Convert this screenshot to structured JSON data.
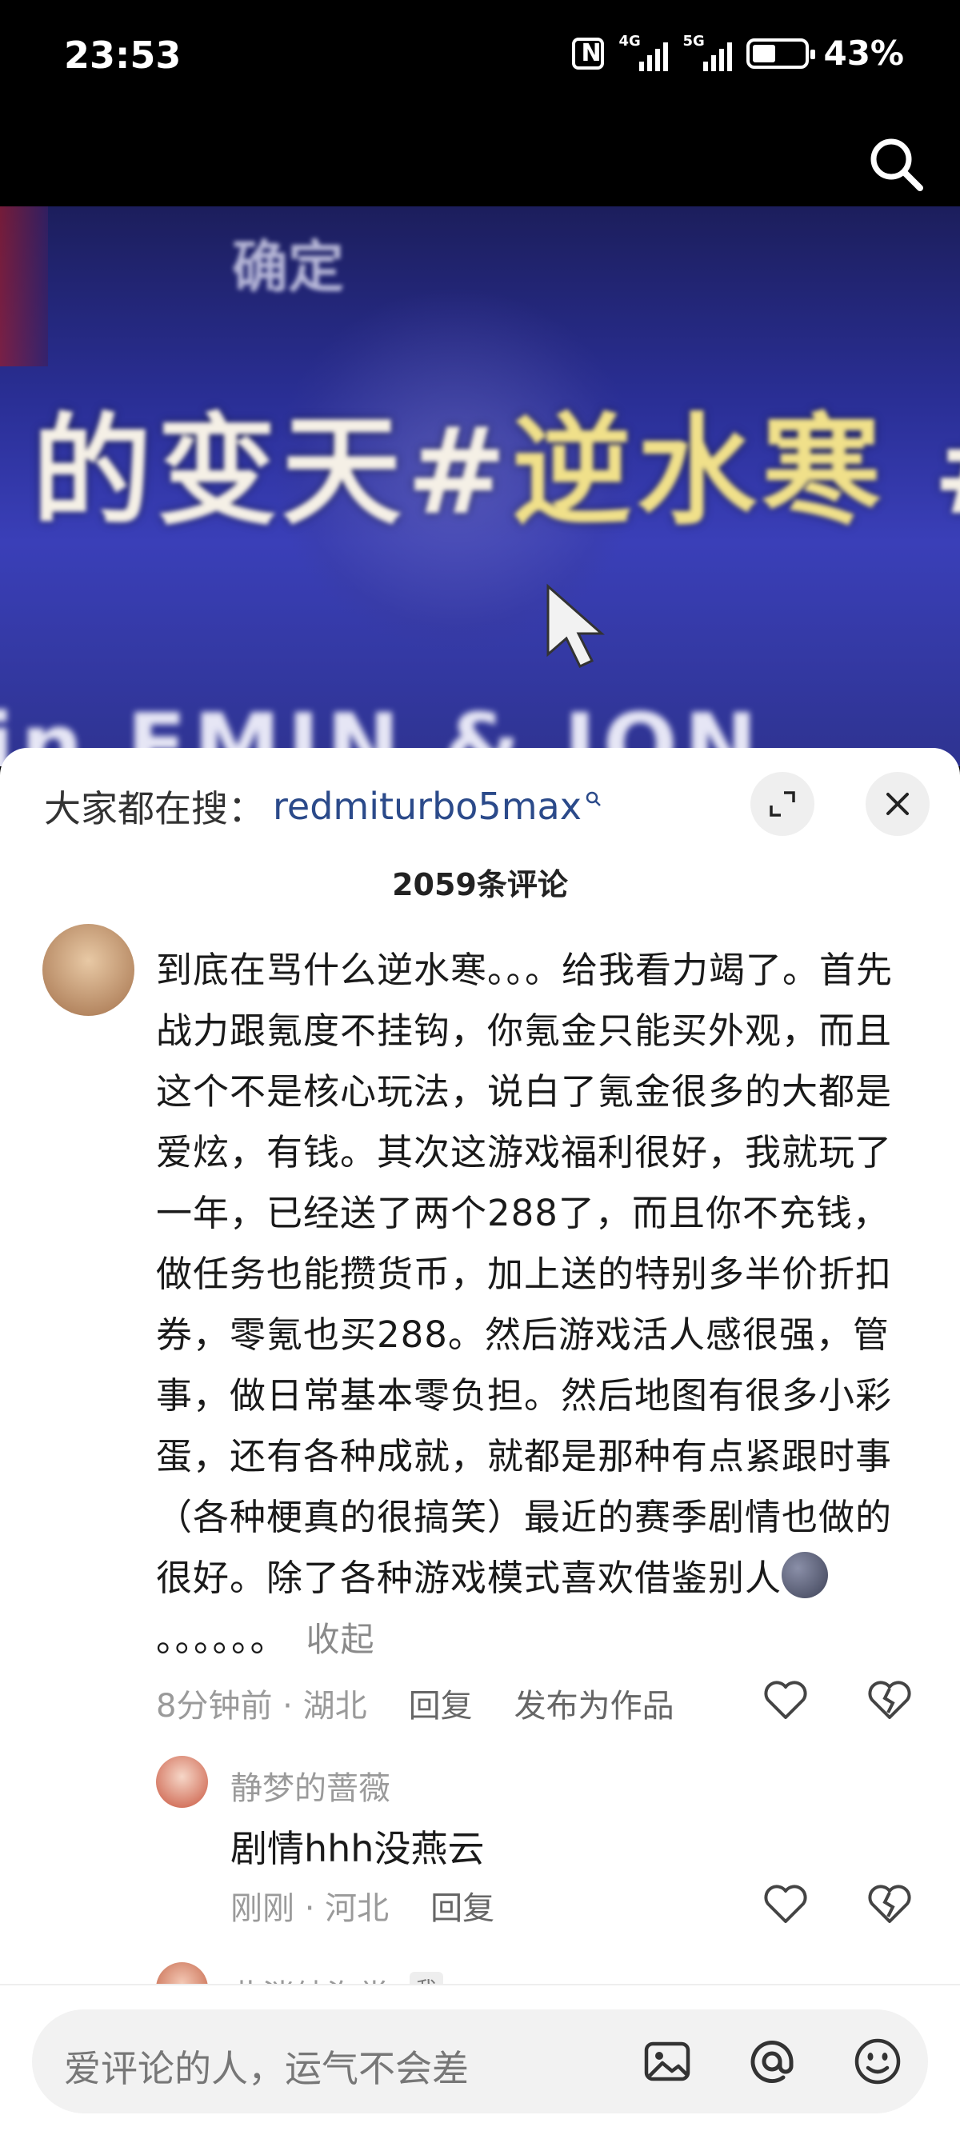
{
  "status_bar": {
    "time": "23:53",
    "signal1_label": "4G",
    "signal2_label": "5G",
    "battery_percent": "43%"
  },
  "video": {
    "banner_text": "的变天#逆水寒 #",
    "banner_highlight": "逆水寒",
    "top_text": "确定",
    "bottom_text": "in EMIN & JON"
  },
  "sheet": {
    "hot_search_label": "大家都在搜：",
    "hot_search_keyword": "redmiturbo5max",
    "comment_count": "2059条评论"
  },
  "comment": {
    "text": "到底在骂什么逆水寒。。。给我看力竭了。首先战力跟氪度不挂钩，你氪金只能买外观，而且这个不是核心玩法，说白了氪金很多的大都是爱炫，有钱。其次这游戏福利很好，我就玩了一年，已经送了两个288了，而且你不充钱，做任务也能攒货币，加上送的特别多半价折扣券，零氪也买288。然后游戏活人感很强，管事，做日常基本零负担。然后地图有很多小彩蛋，还有各种成就，就都是那种有点紧跟时事（各种梗真的很搞笑）最近的赛季剧情也做的很好。除了各种游戏模式喜欢借鉴别人",
    "tail": "。。。。。。",
    "collapse_label": "收起",
    "time": "8分钟前 · 湖北",
    "reply_label": "回复",
    "publish_label": "发布为作品"
  },
  "reply": {
    "username": "静梦的蔷薇",
    "text": "剧情hhh没燕云",
    "time": "刚刚 · 河北",
    "reply_label": "回复"
  },
  "next_reply": {
    "username": "此淌纯海棠",
    "badge": "我"
  },
  "input": {
    "placeholder": "爱评论的人，运气不会差"
  },
  "icons": [
    "nfc-icon",
    "signal-icon",
    "battery-icon",
    "search-icon",
    "expand-icon",
    "close-icon",
    "like-icon",
    "dislike-icon",
    "image-icon",
    "at-icon",
    "emoji-icon"
  ]
}
